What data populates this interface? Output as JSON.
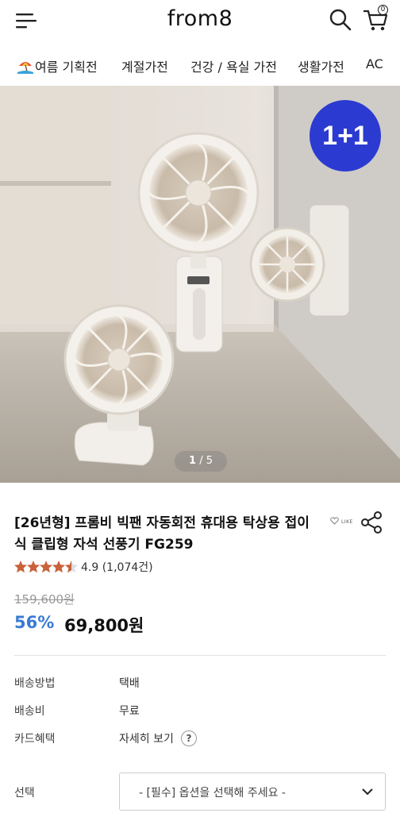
{
  "header": {
    "logo": "from8",
    "cart_count": "0"
  },
  "nav": {
    "items": [
      {
        "label": "여름 기획전",
        "icon": "beach-umbrella-icon"
      },
      {
        "label": "계절가전"
      },
      {
        "label": "건강 / 욕실 가전"
      },
      {
        "label": "생활가전"
      },
      {
        "label": "AC"
      }
    ]
  },
  "hero": {
    "badge": "1+1",
    "pager_current": "1",
    "pager_sep": "/",
    "pager_total": "5"
  },
  "product": {
    "title": "[26년형] 프롬비 빅팬 자동회전 휴대용 탁상용 접이식 클립형 자석 선풍기 FG259",
    "like_label": "LIKE",
    "rating": "4.9 (1,074건)",
    "stars": 4.5,
    "original_price": "159,600원",
    "discount": "56%",
    "price": "69,800원"
  },
  "info": {
    "rows": [
      {
        "label": "배송방법",
        "value": "택배"
      },
      {
        "label": "배송비",
        "value": "무료"
      },
      {
        "label": "카드혜택",
        "value": "자세히 보기"
      }
    ],
    "help": "?"
  },
  "option": {
    "label": "선택",
    "placeholder": "- [필수] 옵션을 선택해 주세요 -"
  },
  "colors": {
    "discount": "#3a7bd5",
    "badge": "#2b3bd1",
    "star": "#c8623a"
  }
}
